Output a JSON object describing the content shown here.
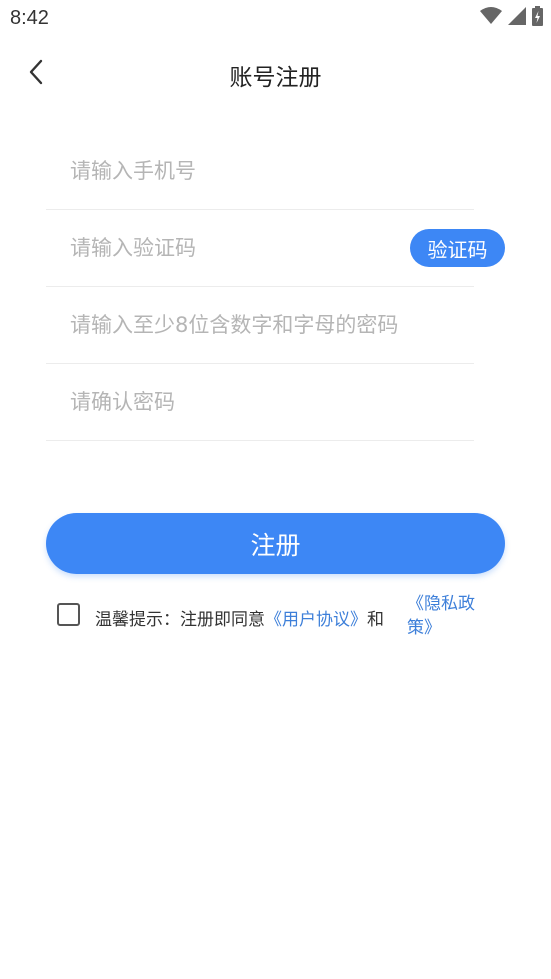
{
  "status_bar": {
    "time": "8:42",
    "icons": [
      "wifi-icon",
      "signal-icon",
      "battery-charging-icon"
    ]
  },
  "header": {
    "title": "账号注册",
    "back_icon": "chevron-left-icon"
  },
  "form": {
    "phone": {
      "placeholder": "请输入手机号",
      "value": ""
    },
    "code": {
      "placeholder": "请输入验证码",
      "value": ""
    },
    "code_button_label": "验证码",
    "password": {
      "placeholder": "请输入至少8位含数字和字母的密码",
      "value": ""
    },
    "confirm_password": {
      "placeholder": "请确认密码",
      "value": ""
    }
  },
  "register_button_label": "注册",
  "agreement": {
    "prefix": "温馨提示：注册即同意",
    "user_agreement_link": "《用户协议》",
    "and_text": "和",
    "privacy_policy_link": "《隐私政策》",
    "checked": false
  },
  "colors": {
    "accent": "#3d87f5",
    "link": "#3d7fd9",
    "placeholder": "#b5b5b5",
    "divider": "#ececec"
  }
}
